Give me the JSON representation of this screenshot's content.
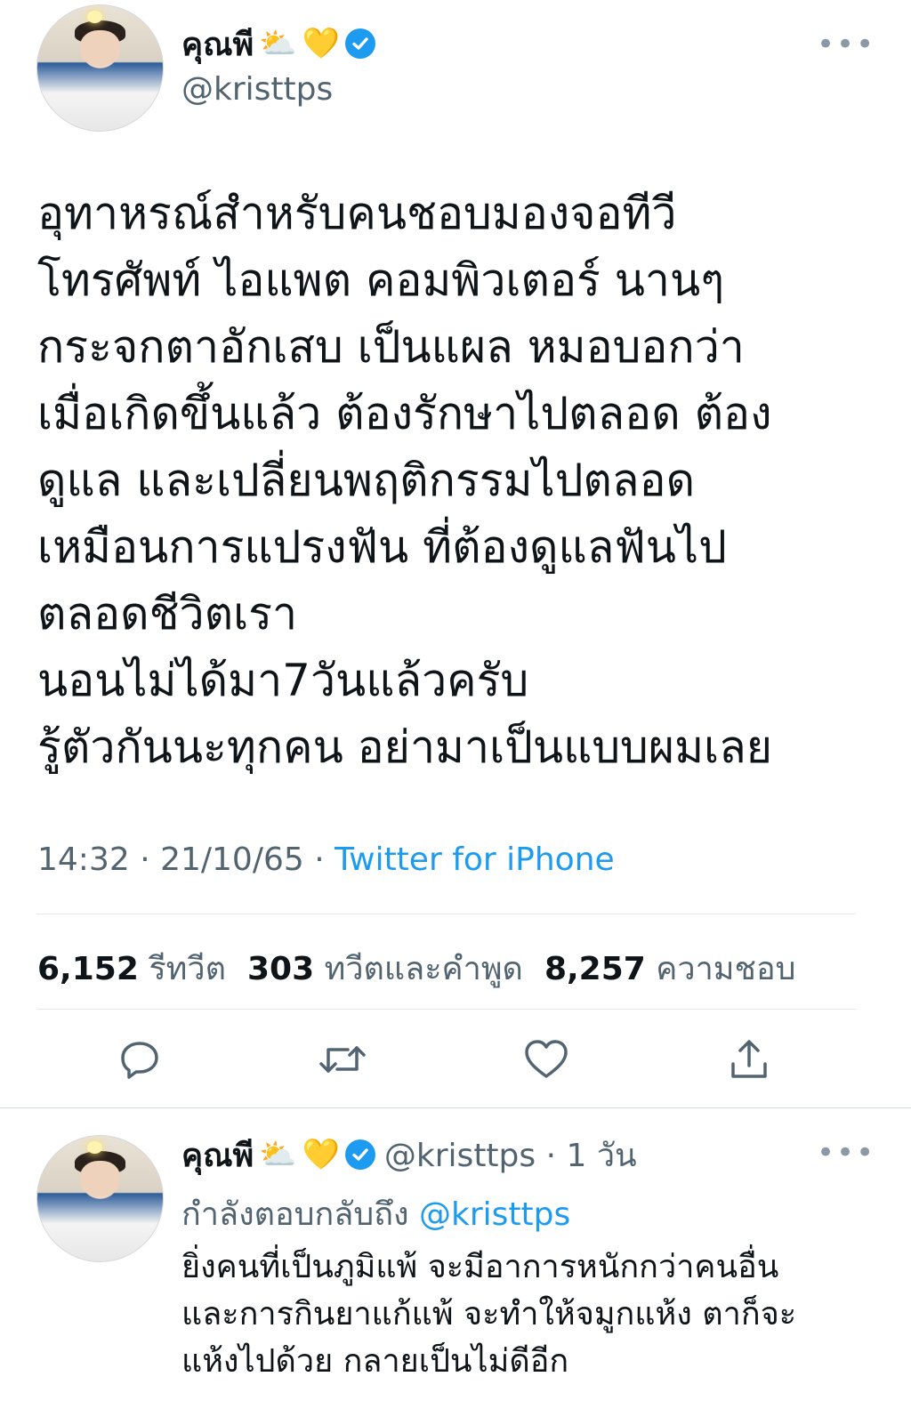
{
  "tweet": {
    "author_name": "คุณพี",
    "emoji_1": "⛅",
    "emoji_2": "💛",
    "handle": "@kristtps",
    "more": "•••",
    "lines": [
      "อุทาหรณ์สำหรับคนชอบมองจอทีวี",
      "โทรศัพท์ ไอแพต คอมพิวเตอร์ นานๆ",
      "กระจกตาอักเสบ เป็นแผล หมอบอกว่า",
      "เมื่อเกิดขึ้นแล้ว ต้องรักษาไปตลอด ต้อง",
      "ดูแล และเปลี่ยนพฤติกรรมไปตลอด",
      "เหมือนการแปรงฟัน ที่ต้องดูแลฟันไป",
      "ตลอดชีวิตเรา",
      "นอนไม่ได้มา7วันแล้วครับ",
      "รู้ตัวกันนะทุกคน อย่ามาเป็นแบบผมเลย"
    ],
    "time": "14:32 · 21/10/65 · ",
    "source": "Twitter for iPhone",
    "stats": {
      "retweets_count": "6,152",
      "retweets_label": "รีทวีต",
      "quotes_count": "303",
      "quotes_label": "ทวีตและคำพูด",
      "likes_count": "8,257",
      "likes_label": "ความชอบ"
    }
  },
  "reply": {
    "author_name": "คุณพี",
    "emoji_1": "⛅",
    "emoji_2": "💛",
    "handle_time": "@kristtps · 1 วัน",
    "replying_prefix": "กำลังตอบกลับถึง ",
    "replying_handle": "@kristtps",
    "more": "•••",
    "lines": [
      "ยิ่งคนที่เป็นภูมิแพ้ จะมีอาการหนักกว่าคนอื่น",
      "และการกินยาแก้แพ้ จะทำให้จมูกแห้ง ตาก็จะ",
      "แห้งไปด้วย กลายเป็นไม่ดีอีก"
    ]
  },
  "icons": [
    "reply-icon",
    "retweet-icon",
    "like-icon",
    "share-icon",
    "verified-icon",
    "more-icon"
  ],
  "colors": {
    "accent": "#1d9bf0",
    "muted": "#536471",
    "text": "#0f1419"
  }
}
